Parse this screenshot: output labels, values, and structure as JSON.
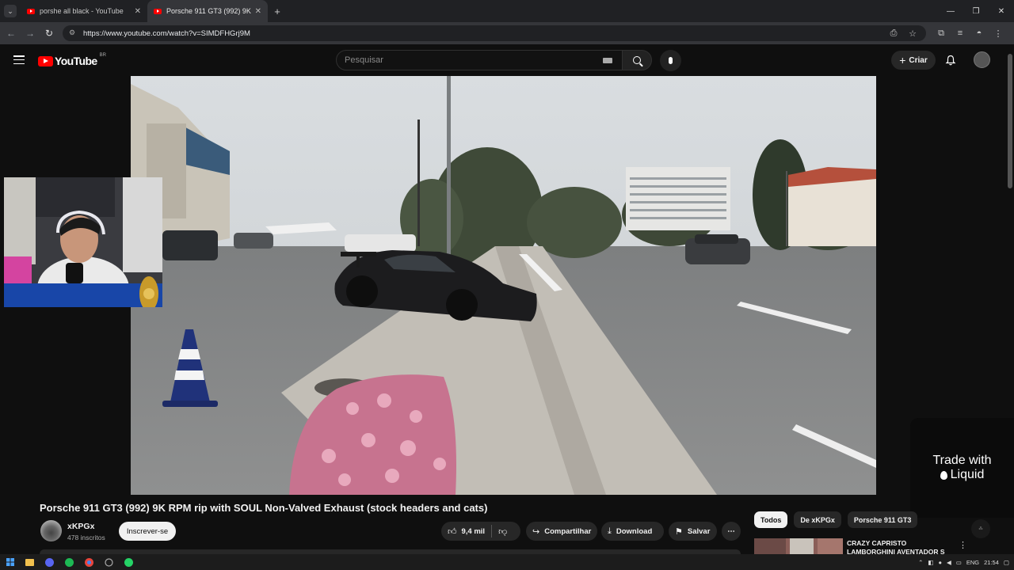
{
  "browser": {
    "tabs": [
      {
        "title": "porshe all black - YouTube",
        "active": false
      },
      {
        "title": "Porsche 911 GT3 (992) 9K RPM",
        "active": true
      }
    ],
    "url": "https://www.youtube.com/watch?v=SIMDFHGrj9M"
  },
  "youtube": {
    "logo_text": "YouTube",
    "country_code": "BR",
    "search_placeholder": "Pesquisar",
    "create_label": "Criar"
  },
  "ad": {
    "line1": "Trade with",
    "line2": "Liquid"
  },
  "video": {
    "title": "Porsche 911 GT3 (992) 9K RPM rip with SOUL Non-Valved Exhaust (stock headers and cats)",
    "channel_name": "xKPGx",
    "subscribers": "478 inscritos",
    "subscribe_label": "Inscrever-se",
    "likes": "9,4 mil",
    "share_label": "Compartilhar",
    "download_label": "Download",
    "save_label": "Salvar"
  },
  "sidebar": {
    "chips": [
      {
        "label": "Todos",
        "active": true
      },
      {
        "label": "De xKPGx",
        "active": false
      },
      {
        "label": "Porsche 911 GT3",
        "active": false
      }
    ],
    "recommendation_title": "CRAZY CAPRISTO LAMBORGHINI AVENTADOR S"
  },
  "taskbar": {
    "language": "ENG",
    "time": "21:54"
  },
  "colors": {
    "youtube_red": "#ff0000",
    "background": "#0f0f0f",
    "chip_bg": "#272727"
  }
}
